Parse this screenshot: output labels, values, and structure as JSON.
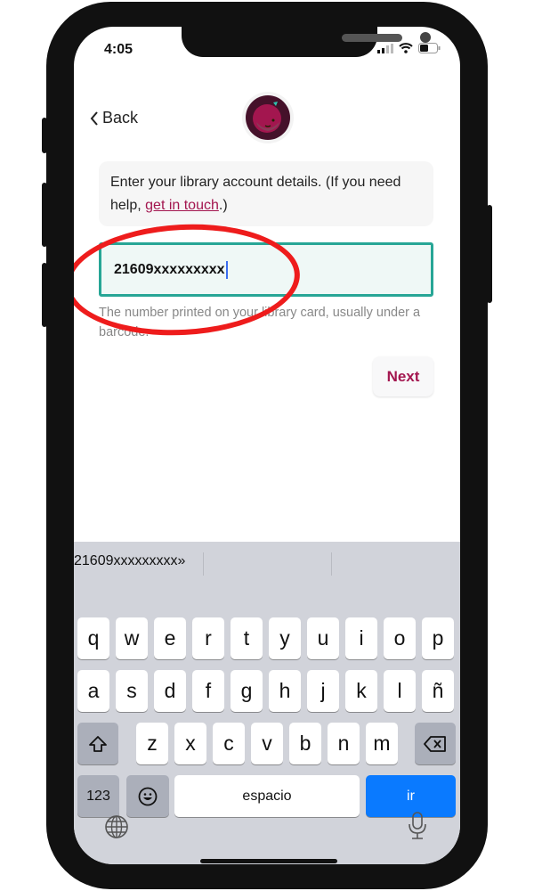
{
  "status_bar": {
    "time": "4:05",
    "icons": [
      "signal-icon",
      "wifi-icon",
      "battery-icon"
    ]
  },
  "nav": {
    "back_label": "Back",
    "logo": "libby-logo"
  },
  "info": {
    "text_before": "Enter your library account details. (If you need help, ",
    "link": "get in touch",
    "text_after": ".)"
  },
  "card_field": {
    "value": "21609xxxxxxxxx",
    "hint": "The number printed on your library card, usually under a barcode."
  },
  "next_label": "Next",
  "colors": {
    "accent": "#a3164f",
    "field_border": "#27a696",
    "annotation_ring": "#ee1c1c",
    "go_key": "#0a7aff"
  },
  "keyboard": {
    "suggestion": "21609xxxxxxxxx»",
    "row1": [
      "q",
      "w",
      "e",
      "r",
      "t",
      "y",
      "u",
      "i",
      "o",
      "p"
    ],
    "row2": [
      "a",
      "s",
      "d",
      "f",
      "g",
      "h",
      "j",
      "k",
      "l",
      "ñ"
    ],
    "row3": [
      "z",
      "x",
      "c",
      "v",
      "b",
      "n",
      "m"
    ],
    "numbers_label": "123",
    "space_label": "espacio",
    "go_label": "ir"
  }
}
